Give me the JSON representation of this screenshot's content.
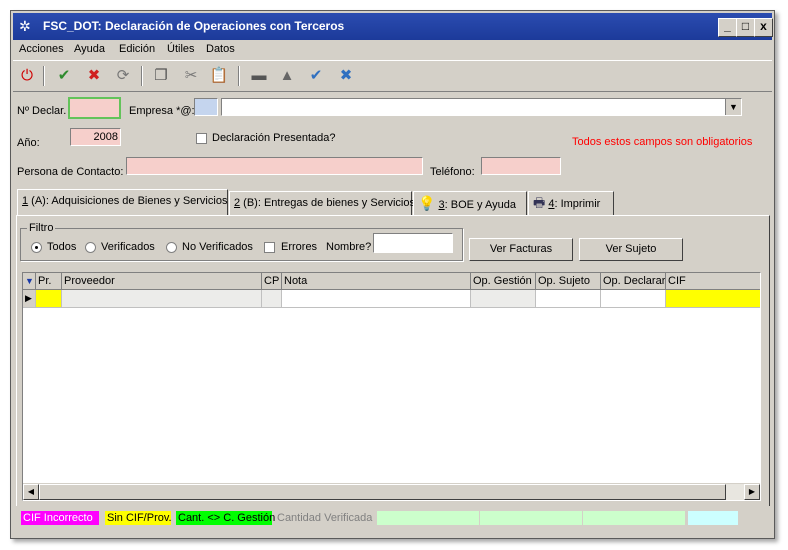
{
  "window": {
    "title": "FSC_DOT: Declaración de Operaciones con Terceros",
    "min": "_",
    "max": "□",
    "close": "x"
  },
  "menu": [
    "Acciones",
    "Ayuda",
    "Edición",
    "Útiles",
    "Datos"
  ],
  "toolbar": {
    "icons": [
      "power-icon",
      "accept-all-icon",
      "cancel-all-icon",
      "refresh-icon",
      "copy-icon",
      "cut-icon",
      "paste-icon",
      "minus-icon",
      "up-icon",
      "check-icon",
      "x-icon"
    ]
  },
  "form": {
    "num_declar_label": "Nº Declar.",
    "num_declar_value": "",
    "empresa_label": "Empresa *@:",
    "empresa_code": "",
    "empresa_name": "",
    "anio_label": "Año:",
    "anio_value": "2008",
    "presentada_label": "Declaración Presentada?",
    "required_note": "Todos estos campos son obligatorios",
    "contacto_label": "Persona de Contacto:",
    "contacto_value": "",
    "telefono_label": "Teléfono:",
    "telefono_value": ""
  },
  "tabs": [
    {
      "num": "1",
      "label": " (A): Adquisiciones de Bienes y Servicios"
    },
    {
      "num": "2",
      "label": " (B): Entregas de bienes y Servicios"
    },
    {
      "num": "3",
      "label": ": BOE y Ayuda"
    },
    {
      "num": "4",
      "label": ": Imprimir"
    }
  ],
  "filter": {
    "title": "Filtro",
    "options": [
      "Todos",
      "Verificados",
      "No Verificados"
    ],
    "errores_label": "Errores",
    "nombre_label": "Nombre?",
    "nombre_value": ""
  },
  "buttons": {
    "ver_facturas": "Ver Facturas",
    "ver_sujeto": "Ver Sujeto"
  },
  "grid": {
    "headers": [
      "Pr.",
      "Proveedor",
      "CP",
      "Nota",
      "Op. Gestión",
      "Op. Sujeto",
      "Op. Declarar",
      "CIF"
    ]
  },
  "legend": [
    "CIF Incorrecto",
    "Sin CIF/Prov.",
    "Cant. <> C. Gestión",
    "Cantidad Verificada"
  ],
  "colors": {
    "magenta": "#ff00ff",
    "yellow": "#ffff00",
    "green": "#00ff00",
    "pink": "#f6cfcb",
    "red_text": "#ff0000",
    "light_green": "#ccffcc",
    "light_cyan": "#ccffff"
  }
}
